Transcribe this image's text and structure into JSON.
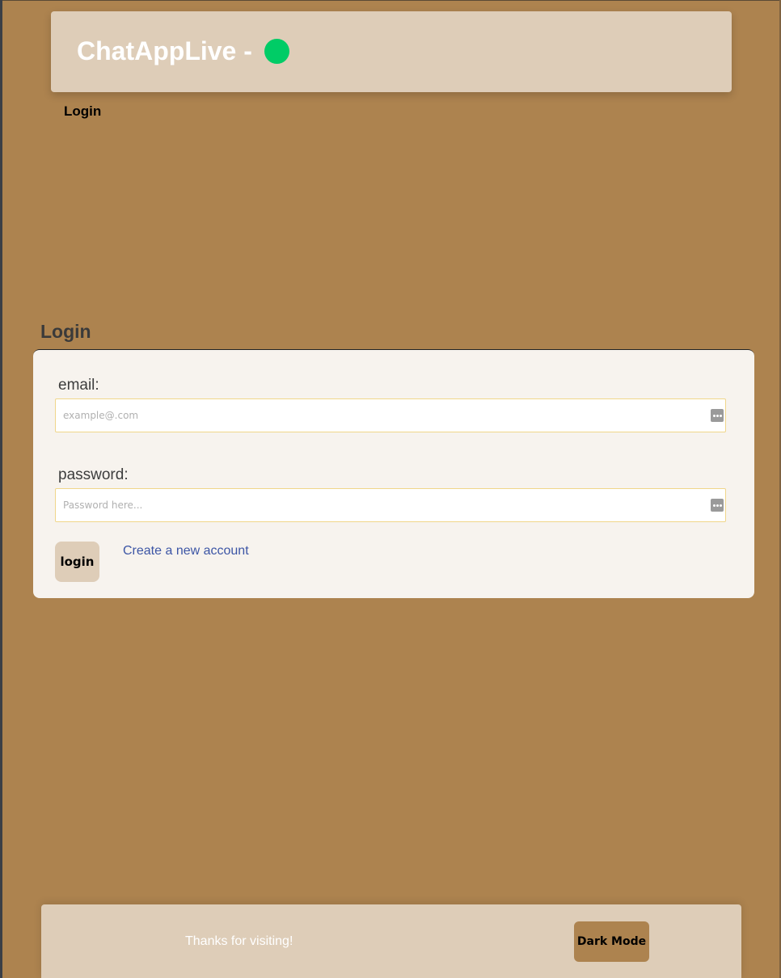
{
  "header": {
    "title": "ChatAppLive -",
    "status_color": "#00cc66"
  },
  "nav": {
    "login_label": "Login"
  },
  "login_section": {
    "title": "Login",
    "email": {
      "label": "email:",
      "placeholder": "example@.com",
      "value": ""
    },
    "password": {
      "label": "password:",
      "placeholder": "Password here...",
      "value": ""
    },
    "login_button": "login",
    "create_account_link": "Create a new account"
  },
  "footer": {
    "message": "Thanks for visiting!",
    "dark_mode_button": "Dark Mode"
  },
  "colors": {
    "background": "#ad834f",
    "panel": "#decdb8",
    "card": "#f7f3ee",
    "link": "#3c55a5",
    "input_border": "#f0d68a"
  }
}
